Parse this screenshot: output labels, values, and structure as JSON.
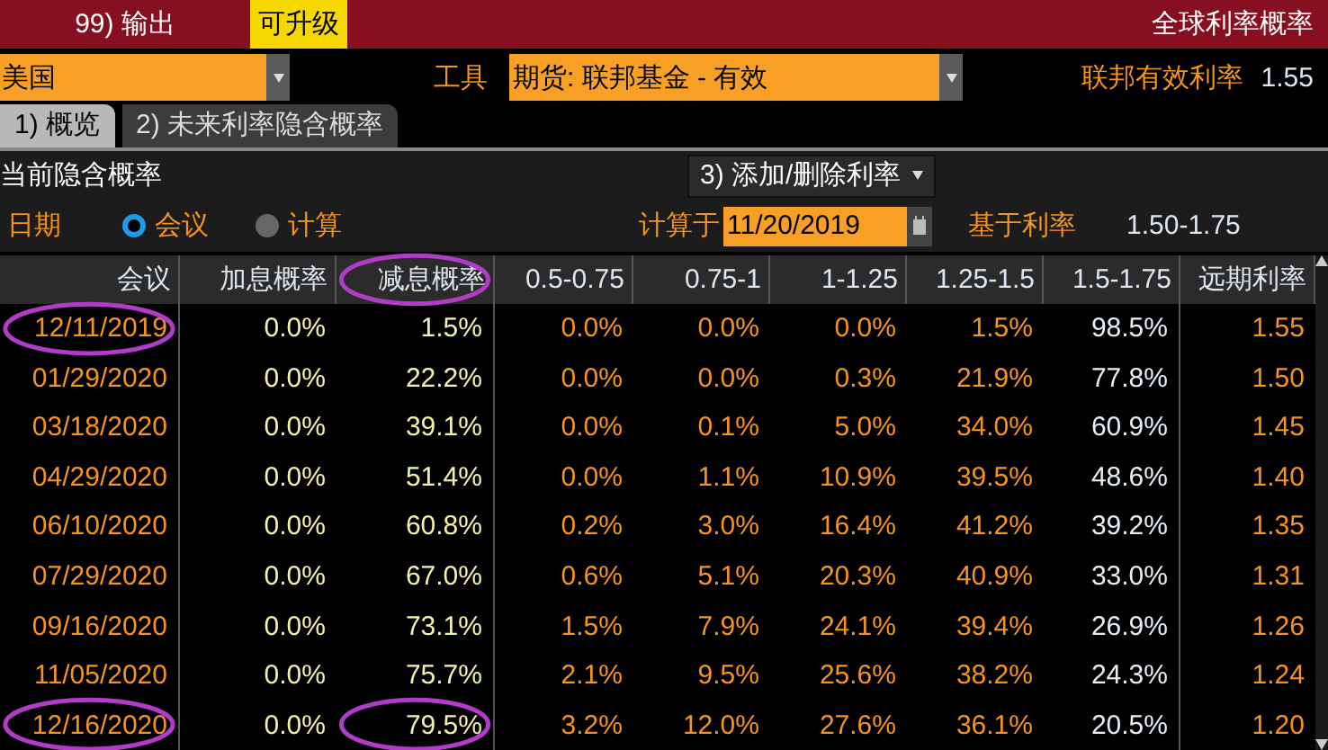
{
  "top_bar": {
    "export_button": "99) 输出",
    "upgrade_badge": "可升级",
    "title": "全球利率概率"
  },
  "controls": {
    "country": "美国",
    "instrument_label": "工具",
    "instrument": "期货: 联邦基金 - 有效",
    "effective_rate_label": "联邦有效利率",
    "effective_rate": "1.55"
  },
  "tabs": [
    {
      "label": "1) 概览",
      "selected": true
    },
    {
      "label": "2) 未来利率隐含概率",
      "selected": false
    }
  ],
  "section": {
    "title": "当前隐含概率",
    "add_remove_button": "3) 添加/删除利率"
  },
  "options": {
    "date_label": "日期",
    "radios": [
      {
        "label": "会议",
        "selected": true
      },
      {
        "label": "计算",
        "selected": false
      }
    ],
    "calc_label": "计算于",
    "calc_date": "11/20/2019",
    "base_rate_label": "基于利率",
    "base_rate": "1.50-1.75"
  },
  "table": {
    "columns": [
      {
        "label": "会议",
        "kind": "date",
        "circled": false
      },
      {
        "label": "加息概率",
        "kind": "prob",
        "circled": false
      },
      {
        "label": "减息概率",
        "kind": "prob",
        "circled": true
      },
      {
        "label": "0.5-0.75",
        "kind": "range",
        "circled": false
      },
      {
        "label": "0.75-1",
        "kind": "range",
        "circled": false
      },
      {
        "label": "1-1.25",
        "kind": "range",
        "circled": false
      },
      {
        "label": "1.25-1.5",
        "kind": "range",
        "circled": false
      },
      {
        "label": "1.5-1.75",
        "kind": "current_range",
        "circled": false
      },
      {
        "label": "远期利率",
        "kind": "rate",
        "circled": false
      }
    ],
    "rows": [
      {
        "cells": [
          "12/11/2019",
          "0.0%",
          "1.5%",
          "0.0%",
          "0.0%",
          "0.0%",
          "1.5%",
          "98.5%",
          "1.55"
        ],
        "date_circled": true,
        "cut_circled": false
      },
      {
        "cells": [
          "01/29/2020",
          "0.0%",
          "22.2%",
          "0.0%",
          "0.0%",
          "0.3%",
          "21.9%",
          "77.8%",
          "1.50"
        ],
        "date_circled": false,
        "cut_circled": false
      },
      {
        "cells": [
          "03/18/2020",
          "0.0%",
          "39.1%",
          "0.0%",
          "0.1%",
          "5.0%",
          "34.0%",
          "60.9%",
          "1.45"
        ],
        "date_circled": false,
        "cut_circled": false
      },
      {
        "cells": [
          "04/29/2020",
          "0.0%",
          "51.4%",
          "0.0%",
          "1.1%",
          "10.9%",
          "39.5%",
          "48.6%",
          "1.40"
        ],
        "date_circled": false,
        "cut_circled": false
      },
      {
        "cells": [
          "06/10/2020",
          "0.0%",
          "60.8%",
          "0.2%",
          "3.0%",
          "16.4%",
          "41.2%",
          "39.2%",
          "1.35"
        ],
        "date_circled": false,
        "cut_circled": false
      },
      {
        "cells": [
          "07/29/2020",
          "0.0%",
          "67.0%",
          "0.6%",
          "5.1%",
          "20.3%",
          "40.9%",
          "33.0%",
          "1.31"
        ],
        "date_circled": false,
        "cut_circled": false
      },
      {
        "cells": [
          "09/16/2020",
          "0.0%",
          "73.1%",
          "1.5%",
          "7.9%",
          "24.1%",
          "39.4%",
          "26.9%",
          "1.26"
        ],
        "date_circled": false,
        "cut_circled": false
      },
      {
        "cells": [
          "11/05/2020",
          "0.0%",
          "75.7%",
          "2.1%",
          "9.5%",
          "25.6%",
          "38.2%",
          "24.3%",
          "1.24"
        ],
        "date_circled": false,
        "cut_circled": false
      },
      {
        "cells": [
          "12/16/2020",
          "0.0%",
          "79.5%",
          "3.2%",
          "12.0%",
          "27.6%",
          "36.1%",
          "20.5%",
          "1.20"
        ],
        "date_circled": true,
        "cut_circled": true
      }
    ]
  }
}
